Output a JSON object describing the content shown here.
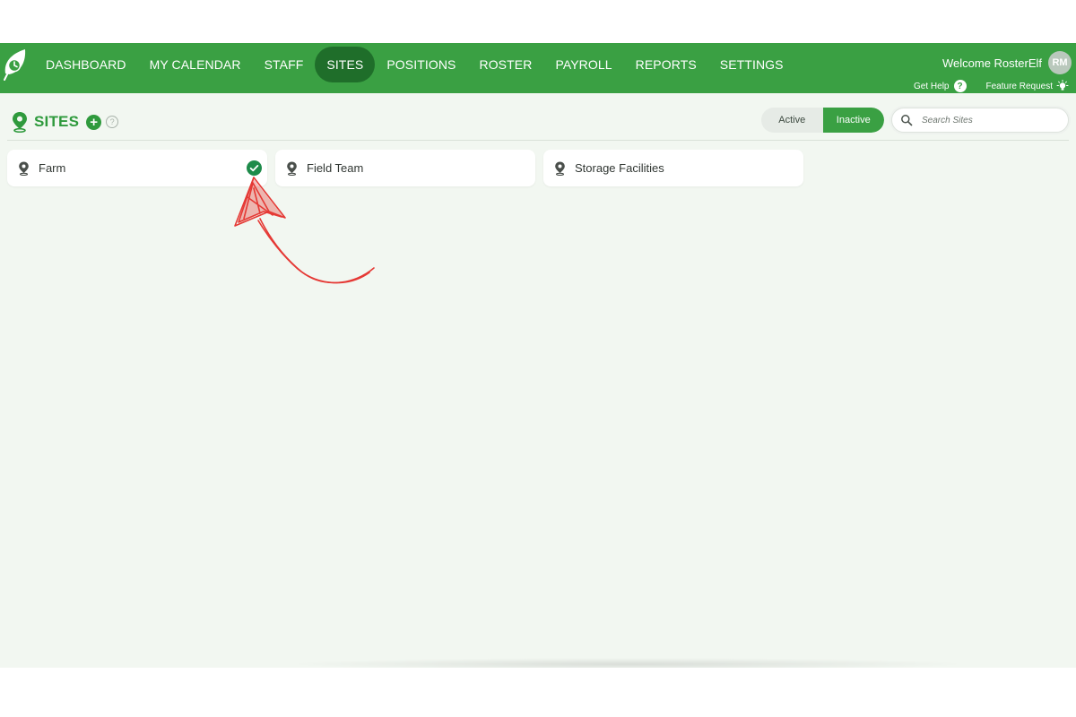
{
  "nav": {
    "items": [
      {
        "label": "DASHBOARD"
      },
      {
        "label": "MY CALENDAR"
      },
      {
        "label": "STAFF"
      },
      {
        "label": "SITES",
        "active": true
      },
      {
        "label": "POSITIONS"
      },
      {
        "label": "ROSTER"
      },
      {
        "label": "PAYROLL"
      },
      {
        "label": "REPORTS"
      },
      {
        "label": "SETTINGS"
      }
    ]
  },
  "user": {
    "welcome": "Welcome RosterElf",
    "initials": "RM",
    "get_help": "Get Help",
    "feature_request": "Feature Request"
  },
  "page": {
    "title": "SITES",
    "filter": {
      "active_label": "Active",
      "inactive_label": "Inactive",
      "selected": "Inactive"
    },
    "search_placeholder": "Search Sites"
  },
  "sites": [
    {
      "name": "Farm",
      "selected": true
    },
    {
      "name": "Field Team",
      "selected": false
    },
    {
      "name": "Storage Facilities",
      "selected": false
    }
  ],
  "icons": {
    "logo": "rosterelf-leaf-clock-logo",
    "site": "map-pin-icon",
    "add": "plus-circle-icon",
    "help": "question-circle-icon",
    "search": "magnifier-icon",
    "selected": "check-circle-icon",
    "feature": "lightbulb-icon"
  },
  "colors": {
    "brand_green": "#3aa043",
    "active_nav": "#1f6e2a",
    "page_bg": "#f2f7f1",
    "check_green": "#1e8b4a",
    "annotation_red": "#e53935"
  }
}
